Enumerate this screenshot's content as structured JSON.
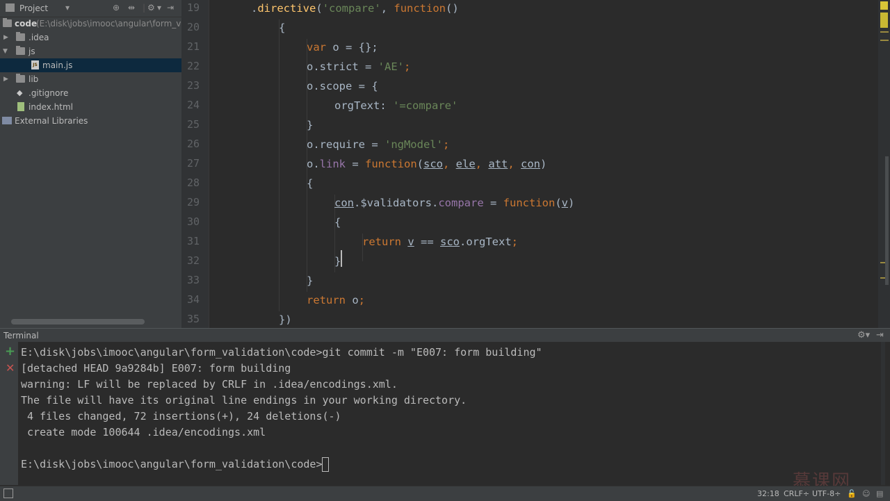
{
  "project_panel": {
    "title": "Project",
    "tree": [
      {
        "label": "code",
        "suffix": "(E:\\disk\\jobs\\imooc\\angular\\form_valic",
        "type": "root"
      },
      {
        "label": ".idea",
        "type": "folder",
        "expanded": false
      },
      {
        "label": "js",
        "type": "folder",
        "expanded": true
      },
      {
        "label": "main.js",
        "type": "js",
        "selected": true
      },
      {
        "label": "lib",
        "type": "folder",
        "expanded": false
      },
      {
        "label": ".gitignore",
        "type": "git"
      },
      {
        "label": "index.html",
        "type": "html"
      },
      {
        "label": "External Libraries",
        "type": "extlib"
      }
    ]
  },
  "editor": {
    "line_numbers": [
      "19",
      "20",
      "21",
      "22",
      "23",
      "24",
      "25",
      "26",
      "27",
      "28",
      "29",
      "30",
      "31",
      "32",
      "33",
      "34",
      "35"
    ],
    "cursor_line": "32"
  },
  "terminal": {
    "title": "Terminal",
    "lines": [
      "E:\\disk\\jobs\\imooc\\angular\\form_validation\\code>git commit -m \"E007: form building\"",
      "[detached HEAD 9a9284b] E007: form building",
      "warning: LF will be replaced by CRLF in .idea/encodings.xml.",
      "The file will have its original line endings in your working directory.",
      " 4 files changed, 72 insertions(+), 24 deletions(-)",
      " create mode 100644 .idea/encodings.xml",
      "",
      "E:\\disk\\jobs\\imooc\\angular\\form_validation\\code>"
    ]
  },
  "status_bar": {
    "position": "32:18",
    "line_separator": "CRLF÷",
    "encoding": "UTF-8÷"
  },
  "watermark": "慕课网",
  "colors": {
    "keyword": "#cc7832",
    "string": "#6a8759",
    "function": "#ffc66d",
    "property": "#9876aa",
    "plain": "#a9b7c6",
    "selection": "#0d293e",
    "add_icon": "#499c54",
    "close_icon": "#c75450"
  }
}
